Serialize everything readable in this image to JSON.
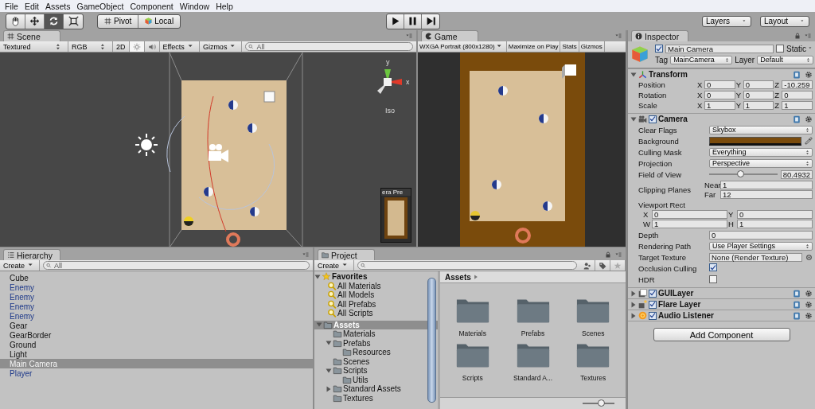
{
  "menu": [
    "File",
    "Edit",
    "Assets",
    "GameObject",
    "Component",
    "Window",
    "Help"
  ],
  "toolbar": {
    "tools": [
      {
        "kind": "hand",
        "selected": false
      },
      {
        "kind": "move",
        "selected": false
      },
      {
        "kind": "rotate",
        "selected": true
      },
      {
        "kind": "scale",
        "selected": false
      }
    ],
    "pivot": "Pivot",
    "local": "Local",
    "playback": [
      {
        "kind": "play"
      },
      {
        "kind": "pause"
      },
      {
        "kind": "step"
      }
    ],
    "layers": "Layers",
    "layout": "Layout"
  },
  "scene": {
    "tab": "Scene",
    "draw_mode": "Textured",
    "render_mode": "RGB",
    "toggles": [
      {
        "kind": "dimension",
        "label": "2D",
        "on": false
      },
      {
        "kind": "lighting",
        "on": true
      },
      {
        "kind": "audio",
        "on": false
      }
    ],
    "effects": "Effects",
    "gizmos": "Gizmos",
    "search_placeholder": "All",
    "axis_y": "y",
    "axis_x": "x",
    "projection": "Iso",
    "preview_title": "era Pre"
  },
  "game": {
    "tab": "Game",
    "resolution": "WXGA Portrait (800x1280)",
    "buttons": [
      "Maximize on Play",
      "Stats",
      "Gizmos"
    ]
  },
  "hierarchy": {
    "tab": "Hierarchy",
    "create": "Create",
    "search_placeholder": "All",
    "items": [
      {
        "label": "Cube",
        "prefab": false,
        "selected": false
      },
      {
        "label": "Enemy",
        "prefab": true,
        "selected": false
      },
      {
        "label": "Enemy",
        "prefab": true,
        "selected": false
      },
      {
        "label": "Enemy",
        "prefab": true,
        "selected": false
      },
      {
        "label": "Enemy",
        "prefab": true,
        "selected": false
      },
      {
        "label": "Gear",
        "prefab": false,
        "selected": false
      },
      {
        "label": "GearBorder",
        "prefab": false,
        "selected": false
      },
      {
        "label": "Ground",
        "prefab": false,
        "selected": false
      },
      {
        "label": "Light",
        "prefab": false,
        "selected": false
      },
      {
        "label": "Main Camera",
        "prefab": false,
        "selected": true
      },
      {
        "label": "Player",
        "prefab": true,
        "selected": false
      }
    ]
  },
  "project": {
    "tab": "Project",
    "create": "Create",
    "favorites": {
      "label": "Favorites",
      "expanded": true,
      "items": [
        "All Materials",
        "All Models",
        "All Prefabs",
        "All Scripts"
      ]
    },
    "tree": [
      {
        "label": "Assets",
        "expanded": true,
        "selected": true,
        "children": [
          {
            "label": "Materials",
            "selected": false
          },
          {
            "label": "Prefabs",
            "expanded": true,
            "selected": false,
            "children": [
              {
                "label": "Resources",
                "selected": false
              }
            ]
          },
          {
            "label": "Scenes",
            "selected": false
          },
          {
            "label": "Scripts",
            "expanded": true,
            "selected": false,
            "children": [
              {
                "label": "Utils",
                "selected": false
              }
            ]
          },
          {
            "label": "Standard Assets",
            "expanded": false,
            "selected": false
          },
          {
            "label": "Textures",
            "selected": false
          }
        ]
      }
    ],
    "breadcrumb": "Assets",
    "folders": [
      "Materials",
      "Prefabs",
      "Scenes",
      "Scripts",
      "Standard A...",
      "Textures"
    ],
    "zoom": {
      "level": 0.6
    }
  },
  "inspector": {
    "tab": "Inspector",
    "object": {
      "active": true,
      "name": "Main Camera",
      "static": false,
      "static_label": "Static",
      "tag_label": "Tag",
      "tag": "MainCamera",
      "layer_label": "Layer",
      "layer": "Default"
    },
    "components": [
      {
        "kind": "transform",
        "name": "Transform",
        "expanded": true,
        "rows": [
          {
            "kind": "xyz",
            "label": "Position",
            "fields": [
              {
                "axis": "X",
                "value": "0"
              },
              {
                "axis": "Y",
                "value": "0"
              },
              {
                "axis": "Z",
                "value": "-10.259"
              }
            ]
          },
          {
            "kind": "xyz",
            "label": "Rotation",
            "fields": [
              {
                "axis": "X",
                "value": "0"
              },
              {
                "axis": "Y",
                "value": "0"
              },
              {
                "axis": "Z",
                "value": "0"
              }
            ]
          },
          {
            "kind": "xyz",
            "label": "Scale",
            "fields": [
              {
                "axis": "X",
                "value": "1"
              },
              {
                "axis": "Y",
                "value": "1"
              },
              {
                "axis": "Z",
                "value": "1"
              }
            ]
          }
        ]
      },
      {
        "kind": "camera",
        "name": "Camera",
        "expanded": true,
        "enabled": true,
        "rows": [
          {
            "kind": "dropdown",
            "label": "Clear Flags",
            "value": "Skybox"
          },
          {
            "kind": "color",
            "label": "Background",
            "color": "#7a4b0c"
          },
          {
            "kind": "dropdown",
            "label": "Culling Mask",
            "value": "Everything"
          },
          {
            "kind": "dropdown",
            "label": "Projection",
            "value": "Perspective"
          },
          {
            "kind": "slider",
            "label": "Field of View",
            "level": 0.47,
            "reading": "80.4932"
          },
          {
            "kind": "pair",
            "label": "Clipping Planes",
            "fields": [
              {
                "axis": "Near",
                "value": "1"
              },
              {
                "axis": "Far",
                "value": "12"
              }
            ]
          },
          {
            "kind": "rect",
            "label": "Viewport Rect",
            "fields": [
              {
                "axis": "X",
                "value": "0"
              },
              {
                "axis": "Y",
                "value": "0"
              },
              {
                "axis": "W",
                "value": "1"
              },
              {
                "axis": "H",
                "value": "1"
              }
            ]
          },
          {
            "kind": "text",
            "label": "Depth",
            "value": "0"
          },
          {
            "kind": "dropdown",
            "label": "Rendering Path",
            "value": "Use Player Settings"
          },
          {
            "kind": "object",
            "label": "Target Texture",
            "value": "None (Render Texture)"
          },
          {
            "kind": "checkbox",
            "label": "Occlusion Culling",
            "checked": true
          },
          {
            "kind": "checkbox",
            "label": "HDR",
            "checked": false
          }
        ]
      },
      {
        "kind": "guilayer",
        "name": "GUILayer",
        "expanded": false,
        "enabled": true
      },
      {
        "kind": "flare",
        "name": "Flare Layer",
        "expanded": false,
        "enabled": true
      },
      {
        "kind": "audio",
        "name": "Audio Listener",
        "expanded": false,
        "enabled": true
      }
    ],
    "add_button": "Add Component"
  }
}
